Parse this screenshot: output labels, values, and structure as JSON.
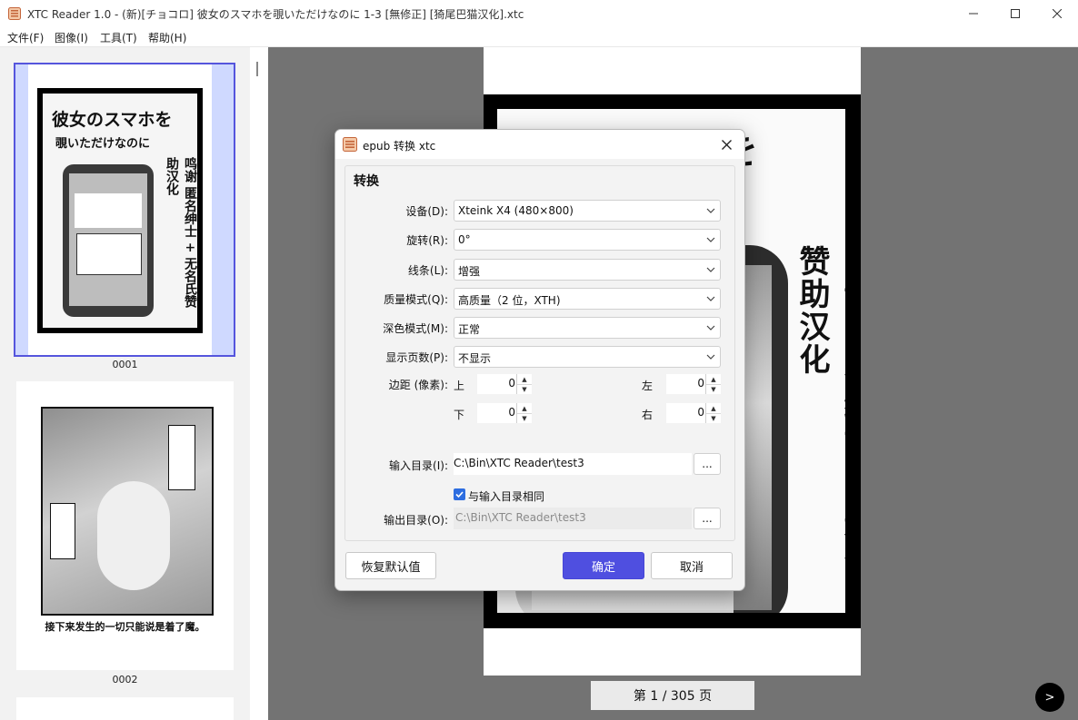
{
  "window": {
    "title": "XTC Reader 1.0 - (新)[チョコロ] 彼女のスマホを覗いただけなのに 1-3 [無修正] [猗尾巴猫汉化].xtc"
  },
  "menu": {
    "file": "文件(F)",
    "image": "图像(I)",
    "tools": "工具(T)",
    "help": "帮助(H)"
  },
  "thumbnails": [
    {
      "label": "0001",
      "selected": true
    },
    {
      "label": "0002",
      "selected": false
    }
  ],
  "cover_text": {
    "line1": "彼女のスマホを",
    "line2": "覗いただけなのに",
    "credit": "鸣谢 匿名绅士 + 无名氏赞助汉化",
    "page2_caption": "接下来发生的一切只能说是着了魔。"
  },
  "viewer": {
    "page_indicator": "第 1 / 305 页",
    "next_label": ">"
  },
  "dialog": {
    "title": "epub 转换 xtc",
    "group_title": "转换",
    "fields": {
      "device": {
        "label": "设备(D):",
        "value": "Xteink X4 (480×800)"
      },
      "rotate": {
        "label": "旋转(R):",
        "value": "0°"
      },
      "lines": {
        "label": "线条(L):",
        "value": "增强"
      },
      "quality": {
        "label": "质量模式(Q):",
        "value": "高质量（2 位，XTH)"
      },
      "dark": {
        "label": "深色模式(M):",
        "value": "正常"
      },
      "pages": {
        "label": "显示页数(P):",
        "value": "不显示"
      }
    },
    "margin": {
      "label": "边距 (像素):",
      "top_label": "上",
      "top": "0",
      "left_label": "左",
      "left": "0",
      "bottom_label": "下",
      "bottom": "0",
      "right_label": "右",
      "right": "0"
    },
    "input_dir": {
      "label": "输入目录(I):",
      "value": "C:\\Bin\\XTC Reader\\test3"
    },
    "same_as_input": {
      "label": "与输入目录相同",
      "checked": true
    },
    "output_dir": {
      "label": "输出目录(O):",
      "value": "C:\\Bin\\XTC Reader\\test3"
    },
    "browse_label": "...",
    "buttons": {
      "restore": "恢复默认值",
      "ok": "确定",
      "cancel": "取消"
    }
  },
  "colors": {
    "accent": "#4f4fe0",
    "selection_border": "#5555dd",
    "checkbox": "#2d6de0"
  }
}
